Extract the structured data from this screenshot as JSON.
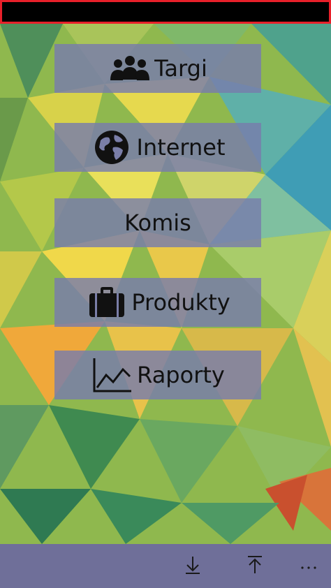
{
  "colors": {
    "status_bar": "#000000",
    "status_bar_border": "#e8202a",
    "button_bg": "#787cac",
    "app_bar": "#6f6f99",
    "text": "#111111"
  },
  "menu": {
    "items": [
      {
        "label": "Targi",
        "icon": "group-users-icon"
      },
      {
        "label": "Internet",
        "icon": "globe-icon"
      },
      {
        "label": "Komis",
        "icon": ""
      },
      {
        "label": "Produkty",
        "icon": "briefcase-icon"
      },
      {
        "label": "Raporty",
        "icon": "line-chart-icon"
      }
    ]
  },
  "app_bar": {
    "buttons": [
      {
        "icon": "download-icon"
      },
      {
        "icon": "upload-icon"
      },
      {
        "icon": "more-icon"
      }
    ]
  }
}
